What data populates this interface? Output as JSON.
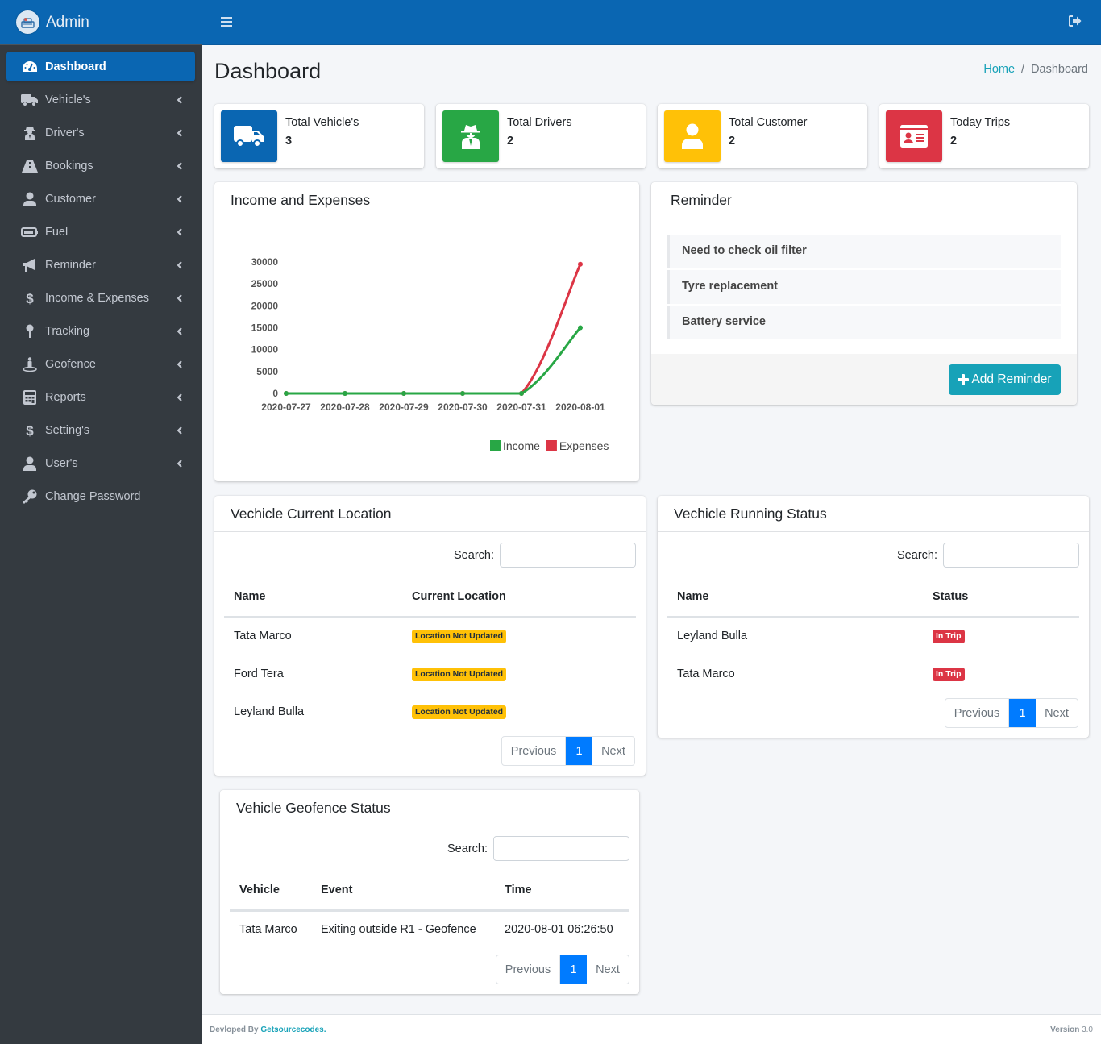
{
  "brand": {
    "title": "Admin"
  },
  "sidebar": {
    "items": [
      {
        "label": "Dashboard",
        "icon": "tachometer-icon",
        "active": true,
        "has_submenu": false
      },
      {
        "label": "Vehicle's",
        "icon": "truck-icon",
        "has_submenu": true
      },
      {
        "label": "Driver's",
        "icon": "user-secret-icon",
        "has_submenu": true
      },
      {
        "label": "Bookings",
        "icon": "road-icon",
        "has_submenu": true
      },
      {
        "label": "Customer",
        "icon": "user-icon",
        "has_submenu": true
      },
      {
        "label": "Fuel",
        "icon": "battery-icon",
        "has_submenu": true
      },
      {
        "label": "Reminder",
        "icon": "bullhorn-icon",
        "has_submenu": true
      },
      {
        "label": "Income & Expenses",
        "icon": "dollar-icon",
        "has_submenu": true
      },
      {
        "label": "Tracking",
        "icon": "map-pin-icon",
        "has_submenu": true
      },
      {
        "label": "Geofence",
        "icon": "street-view-icon",
        "has_submenu": true
      },
      {
        "label": "Reports",
        "icon": "calculator-icon",
        "has_submenu": true
      },
      {
        "label": "Setting's",
        "icon": "dollar-icon",
        "has_submenu": true
      },
      {
        "label": "User's",
        "icon": "user-icon",
        "has_submenu": true
      },
      {
        "label": "Change Password",
        "icon": "key-icon",
        "has_submenu": false
      }
    ]
  },
  "topbar": {
    "menu_icon": "bars-icon",
    "logout_icon": "sign-out-icon"
  },
  "header": {
    "title": "Dashboard",
    "breadcrumb": [
      {
        "label": "Home",
        "link": true
      },
      {
        "label": "Dashboard",
        "link": false
      }
    ]
  },
  "info_boxes": [
    {
      "label": "Total Vehicle's",
      "value": "3",
      "icon": "truck-icon",
      "color": "#0a66b2"
    },
    {
      "label": "Total Drivers",
      "value": "2",
      "icon": "user-secret-icon",
      "color": "#28a745"
    },
    {
      "label": "Total Customer",
      "value": "2",
      "icon": "user-icon",
      "color": "#ffc107"
    },
    {
      "label": "Today Trips",
      "value": "2",
      "icon": "id-card-icon",
      "color": "#dc3545"
    }
  ],
  "income_card": {
    "title": "Income and Expenses"
  },
  "chart_data": {
    "type": "line",
    "title": "Income and Expenses",
    "x": [
      "2020-07-27",
      "2020-07-28",
      "2020-07-29",
      "2020-07-30",
      "2020-07-31",
      "2020-08-01"
    ],
    "series": [
      {
        "name": "Income",
        "color": "#28a745",
        "values": [
          0,
          0,
          0,
          0,
          0,
          15000
        ]
      },
      {
        "name": "Expenses",
        "color": "#dc3545",
        "values": [
          0,
          0,
          0,
          0,
          0,
          29500
        ]
      }
    ],
    "yticks": [
      0,
      5000,
      10000,
      15000,
      20000,
      25000,
      30000
    ],
    "ylim": [
      0,
      30000
    ],
    "xlabel": "",
    "ylabel": "",
    "grid": false,
    "legend": "bottom-right"
  },
  "reminder": {
    "title": "Reminder",
    "items": [
      "Need to check oil filter",
      "Tyre replacement",
      "Battery service"
    ],
    "add_button": "Add Reminder"
  },
  "location_card": {
    "title": "Vechicle Current Location",
    "search_label": "Search:",
    "search_value": "",
    "columns": [
      "Name",
      "Current Location"
    ],
    "rows": [
      {
        "name": "Tata Marco",
        "location": "Location Not Updated"
      },
      {
        "name": "Ford Tera",
        "location": "Location Not Updated"
      },
      {
        "name": "Leyland Bulla",
        "location": "Location Not Updated"
      }
    ],
    "pager": {
      "prev": "Previous",
      "page": "1",
      "next": "Next"
    }
  },
  "status_card": {
    "title": "Vechicle Running Status",
    "search_label": "Search:",
    "search_value": "",
    "columns": [
      "Name",
      "Status"
    ],
    "rows": [
      {
        "name": "Leyland Bulla",
        "status": "In Trip"
      },
      {
        "name": "Tata Marco",
        "status": "In Trip"
      }
    ],
    "pager": {
      "prev": "Previous",
      "page": "1",
      "next": "Next"
    }
  },
  "geofence_card": {
    "title": "Vehicle Geofence Status",
    "search_label": "Search:",
    "search_value": "",
    "columns": [
      "Vehicle",
      "Event",
      "Time"
    ],
    "rows": [
      {
        "vehicle": "Tata Marco",
        "event": "Exiting outside R1 - Geofence",
        "time": "2020-08-01 06:26:50"
      }
    ],
    "pager": {
      "prev": "Previous",
      "page": "1",
      "next": "Next"
    }
  },
  "footer": {
    "developed_by": "Devloped By",
    "company": "Getsourcecodes.",
    "version_label": "Version",
    "version": "3.0"
  }
}
